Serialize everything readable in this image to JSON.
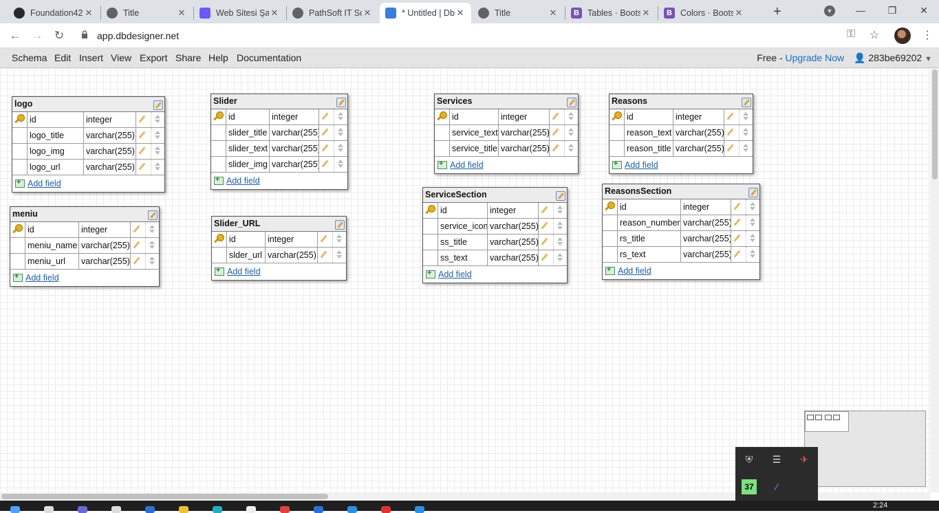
{
  "browser": {
    "tabs": [
      {
        "title": "Foundation42",
        "favicon": "github-icon",
        "active": false
      },
      {
        "title": "Title",
        "favicon": "globe-icon",
        "active": false
      },
      {
        "title": "Web Sitesi Şa",
        "favicon": "web-icon",
        "active": false
      },
      {
        "title": "PathSoft IT So",
        "favicon": "globe-icon",
        "active": false
      },
      {
        "title": "* Untitled | Db",
        "favicon": "dbdesigner-icon",
        "active": true
      },
      {
        "title": "Title",
        "favicon": "globe-icon",
        "active": false
      },
      {
        "title": "Tables · Boots",
        "favicon": "bootstrap-icon",
        "active": false
      },
      {
        "title": "Colors · Boots",
        "favicon": "bootstrap-icon",
        "active": false
      }
    ],
    "url": "app.dbdesigner.net"
  },
  "menu": {
    "items": [
      "Schema",
      "Edit",
      "Insert",
      "View",
      "Export",
      "Share",
      "Help",
      "Documentation"
    ],
    "free_label": "Free - ",
    "upgrade_label": "Upgrade Now",
    "user": "283be69202"
  },
  "schema": {
    "add_field_label": "Add field",
    "tables": [
      {
        "name": "logo",
        "fields": [
          {
            "name": "id",
            "type": "integer",
            "pk": true
          },
          {
            "name": "logo_title",
            "type": "varchar(255)",
            "pk": false
          },
          {
            "name": "logo_img",
            "type": "varchar(255)",
            "pk": false
          },
          {
            "name": "logo_url",
            "type": "varchar(255)",
            "pk": false
          }
        ]
      },
      {
        "name": "meniu",
        "fields": [
          {
            "name": "id",
            "type": "integer",
            "pk": true
          },
          {
            "name": "meniu_name",
            "type": "varchar(255)",
            "pk": false
          },
          {
            "name": "meniu_url",
            "type": "varchar(255)",
            "pk": false
          }
        ]
      },
      {
        "name": "Slider",
        "fields": [
          {
            "name": "id",
            "type": "integer",
            "pk": true
          },
          {
            "name": "slider_title",
            "type": "varchar(255)",
            "pk": false
          },
          {
            "name": "slider_text",
            "type": "varchar(255)",
            "pk": false
          },
          {
            "name": "slider_img",
            "type": "varchar(255)",
            "pk": false
          }
        ]
      },
      {
        "name": "Slider_URL",
        "fields": [
          {
            "name": "id",
            "type": "integer",
            "pk": true
          },
          {
            "name": "slder_url",
            "type": "varchar(255)",
            "pk": false
          }
        ]
      },
      {
        "name": "Services",
        "fields": [
          {
            "name": "id",
            "type": "integer",
            "pk": true
          },
          {
            "name": "service_text",
            "type": "varchar(255)",
            "pk": false
          },
          {
            "name": "service_title",
            "type": "varchar(255)",
            "pk": false
          }
        ]
      },
      {
        "name": "ServiceSection",
        "fields": [
          {
            "name": "id",
            "type": "integer",
            "pk": true
          },
          {
            "name": "service_icon",
            "type": "varchar(255)",
            "pk": false
          },
          {
            "name": "ss_title",
            "type": "varchar(255)",
            "pk": false
          },
          {
            "name": "ss_text",
            "type": "varchar(255)",
            "pk": false
          }
        ]
      },
      {
        "name": "Reasons",
        "fields": [
          {
            "name": "id",
            "type": "integer",
            "pk": true
          },
          {
            "name": "reason_text",
            "type": "varchar(255)",
            "pk": false
          },
          {
            "name": "reason_title",
            "type": "varchar(255)",
            "pk": false
          }
        ]
      },
      {
        "name": "ReasonsSection",
        "fields": [
          {
            "name": "id",
            "type": "integer",
            "pk": true
          },
          {
            "name": "reason_number",
            "type": "varchar(255)",
            "pk": false
          },
          {
            "name": "rs_title",
            "type": "varchar(255)",
            "pk": false
          },
          {
            "name": "rs_text",
            "type": "varchar(255)",
            "pk": false
          }
        ]
      }
    ]
  },
  "tray": {
    "badge": "37"
  },
  "clock": "2:24"
}
